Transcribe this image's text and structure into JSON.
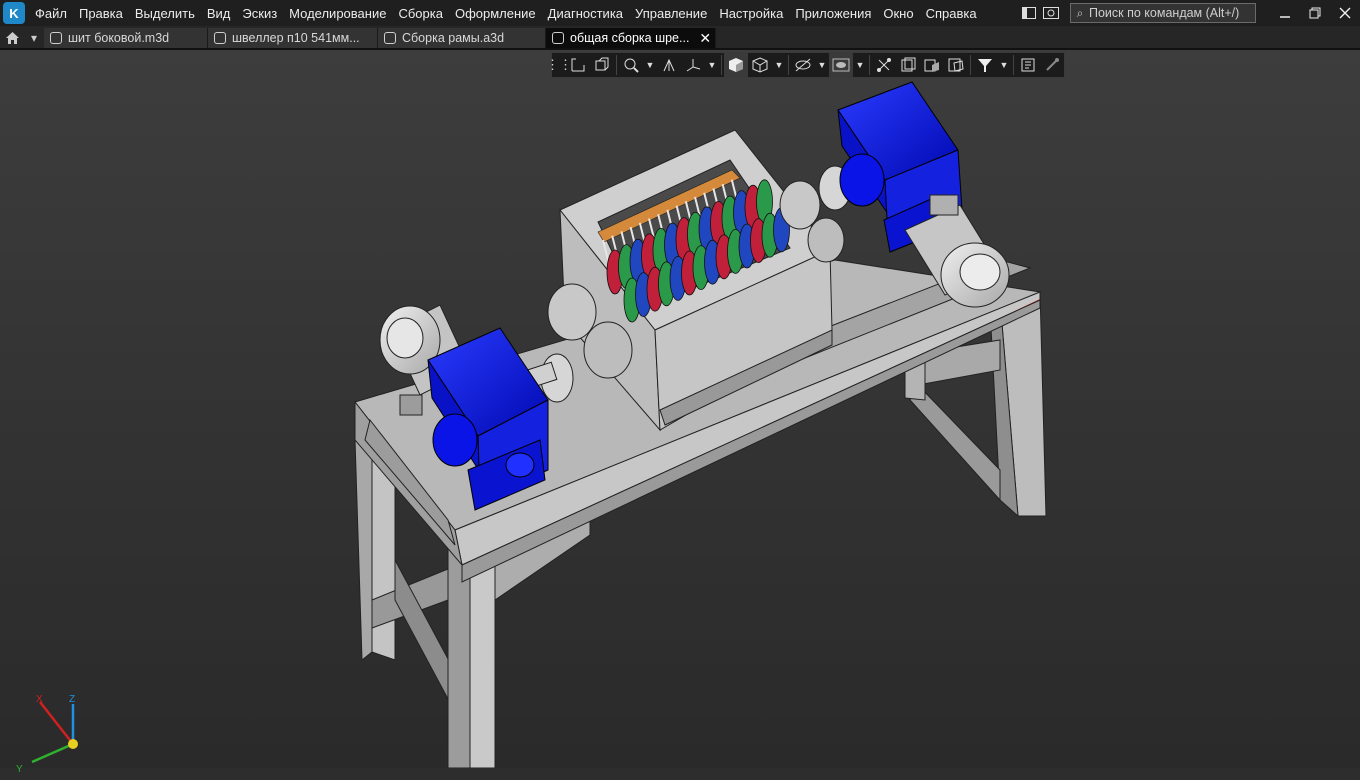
{
  "menu": {
    "items": [
      "Файл",
      "Правка",
      "Выделить",
      "Вид",
      "Эскиз",
      "Моделирование",
      "Сборка",
      "Оформление",
      "Диагностика",
      "Управление",
      "Настройка",
      "Приложения",
      "Окно",
      "Справка"
    ],
    "search_placeholder": "Поиск по командам (Alt+/)"
  },
  "tabs": [
    {
      "label": "шит боковой.m3d",
      "active": false
    },
    {
      "label": "швеллер п10 541мм...",
      "active": false
    },
    {
      "label": "Сборка рамы.a3d",
      "active": false
    },
    {
      "label": "общая сборка  шре...",
      "active": true
    }
  ],
  "view_toolbar": {
    "icons": [
      "grip-icon",
      "sketch-plane-icon",
      "view-orient-icon",
      "zoom-icon",
      "dropdown",
      "rotate-icon",
      "axes-icon",
      "dropdown",
      "shaded-cube-icon",
      "wireframe-cube-icon",
      "dropdown",
      "hide-icon",
      "dropdown",
      "show-icon",
      "dropdown",
      "section-icon",
      "layers-icon",
      "parts-icon",
      "assembly-icon",
      "filter-icon",
      "dropdown",
      "properties-icon",
      "eyedropper-icon"
    ]
  },
  "triad": {
    "x": "X",
    "y": "Y",
    "z": "Z"
  },
  "colors": {
    "frame": "#b9b9b9",
    "gearbox": "#0a14e6",
    "motor": "#d0d0d0",
    "accent_red": "#c8302a",
    "bg": "#343434"
  }
}
